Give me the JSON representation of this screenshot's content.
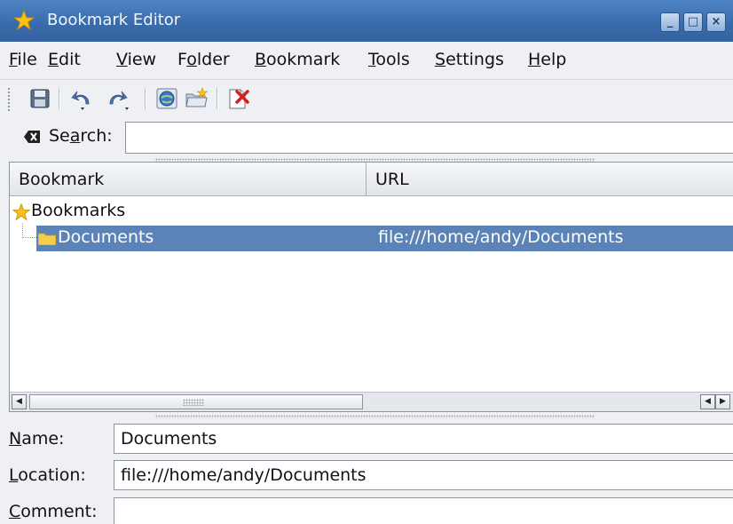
{
  "window": {
    "title": "Bookmark Editor",
    "controls": [
      "_",
      "□",
      "×"
    ]
  },
  "menubar": {
    "items": [
      {
        "pre": "",
        "key": "F",
        "post": "ile"
      },
      {
        "pre": "",
        "key": "E",
        "post": "dit"
      },
      {
        "pre": "",
        "key": "V",
        "post": "iew"
      },
      {
        "pre": "F",
        "key": "o",
        "post": "lder"
      },
      {
        "pre": "",
        "key": "B",
        "post": "ookmark"
      },
      {
        "pre": "",
        "key": "T",
        "post": "ools"
      },
      {
        "pre": "",
        "key": "S",
        "post": "ettings"
      },
      {
        "pre": "",
        "key": "H",
        "post": "elp"
      }
    ]
  },
  "toolbar": {
    "icons": [
      "save-icon",
      "undo-icon",
      "redo-icon",
      "test-link-icon",
      "insert-folder-icon",
      "delete-icon"
    ]
  },
  "search": {
    "label_pre": "Se",
    "label_key": "a",
    "label_post": "rch:",
    "value": ""
  },
  "tree": {
    "columns": [
      "Bookmark",
      "URL"
    ],
    "root": {
      "label": "Bookmarks"
    },
    "selected": {
      "name": "Documents",
      "url": "file:///home/andy/Documents"
    }
  },
  "form": {
    "name": {
      "label_key": "N",
      "label_post": "ame:",
      "value": "Documents"
    },
    "location": {
      "label_key": "L",
      "label_post": "ocation:",
      "value": "file:///home/andy/Documents"
    },
    "comment": {
      "label_key": "C",
      "label_post": "omment:",
      "value": ""
    }
  },
  "colors": {
    "titlebar": "#3a6cad",
    "selection": "#5c83b8",
    "star": "#f5b50a",
    "folder": "#f3cf4a"
  }
}
